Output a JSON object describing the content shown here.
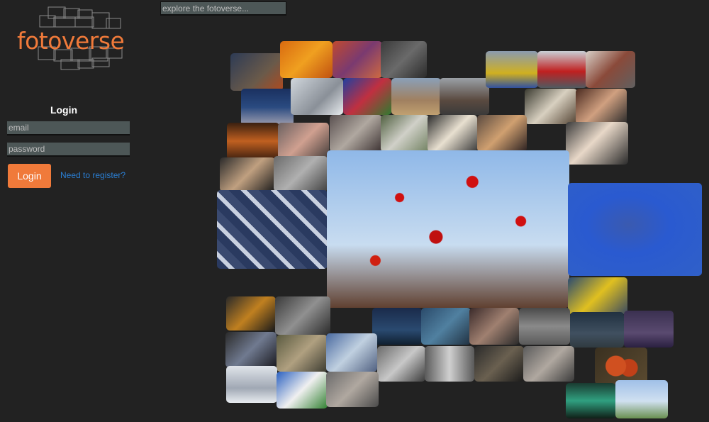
{
  "brand": {
    "name": "fotoverse",
    "accent_color": "#f07a3a"
  },
  "search": {
    "placeholder": "explore the fotoverse..."
  },
  "login": {
    "title": "Login",
    "email_placeholder": "email",
    "password_placeholder": "password",
    "button_label": "Login",
    "register_link": "Need to register?"
  }
}
